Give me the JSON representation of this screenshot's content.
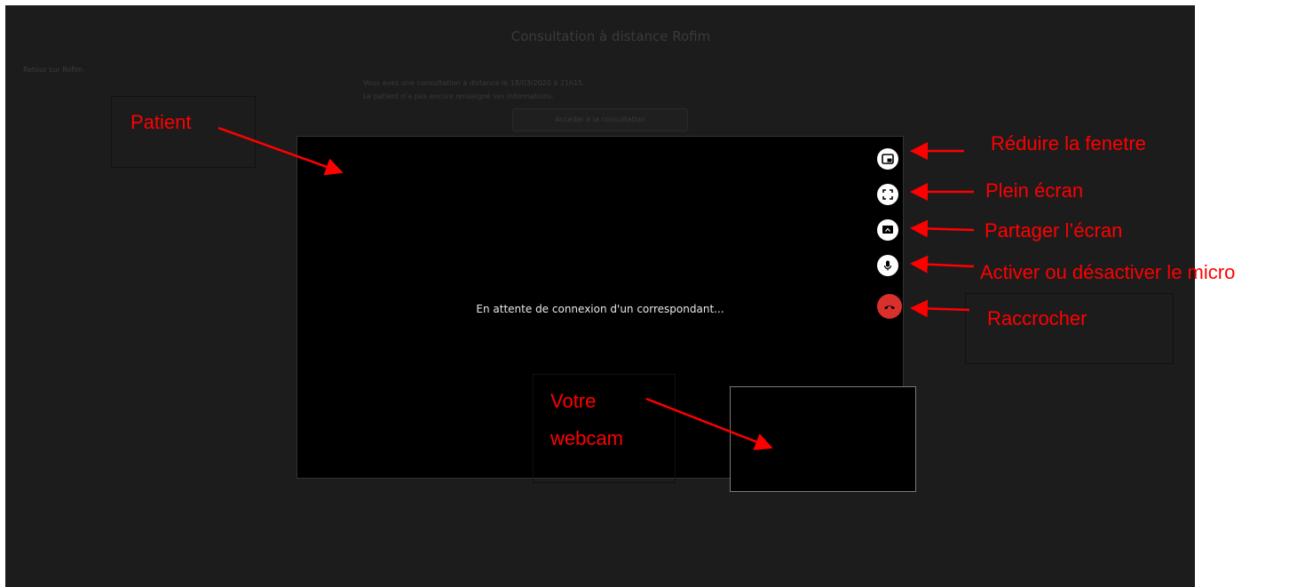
{
  "page": {
    "title": "Consultation à distance Rofim",
    "back_link": "Retour sur Rofim",
    "info_line_1": "Vous avez une consultation à distance le 18/03/2020 à 21h15.",
    "info_line_2": "Le patient n'a pas encore renseigné ses informations.",
    "access_button": "Accéder à la consultation"
  },
  "video": {
    "waiting_text": "En attente de connexion d'un correspondant..."
  },
  "controls": {
    "minimize_icon": "picture-in-picture-icon",
    "fullscreen_icon": "fullscreen-icon",
    "share_icon": "screen-share-icon",
    "mic_icon": "microphone-icon",
    "hangup_icon": "phone-hangup-icon",
    "hangup_color": "#d9302c"
  },
  "annotations": {
    "patient": "Patient",
    "reduce": "Réduire la fenetre",
    "fullscreen": "Plein écran",
    "share": "Partager l’écran",
    "mic": "Activer ou désactiver le micro",
    "hangup": "Raccrocher",
    "webcam_line_1": "Votre",
    "webcam_line_2": "webcam",
    "color": "#ff0000"
  }
}
